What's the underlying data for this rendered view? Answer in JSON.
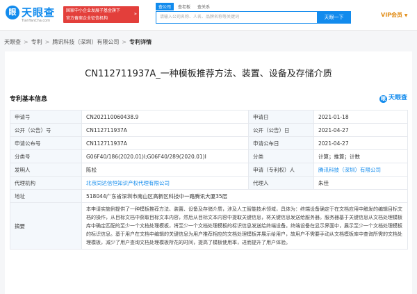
{
  "header": {
    "logo_mark": "眼",
    "logo_text": "天眼查",
    "logo_domain": "TianYanCha.com",
    "promo_line1": "国家中小企业发展子基金旗下",
    "promo_line2": "官方备案企业征信机构",
    "promo_arrow": "»",
    "search_tabs": [
      "查公司",
      "查老板",
      "查关系"
    ],
    "search_placeholder": "请输入公司名称、人名、品牌名称等关键词",
    "search_button": "天眼一下",
    "vip_label": "VIP会员",
    "vip_caret": "▼"
  },
  "breadcrumb": {
    "items": [
      "天眼查",
      "专利",
      "腾讯科技（深圳）有限公司",
      "专利详情"
    ],
    "separator": ">"
  },
  "page": {
    "title": "CN112711937A_一种模板推荐方法、装置、设备及存储介质",
    "section_title": "专利基本信息",
    "brand_mark_dot": "眼",
    "brand_mark_text": "天眼查"
  },
  "info": {
    "apply_no_label": "申请号",
    "apply_no": "CN202110060438.9",
    "apply_date_label": "申请日",
    "apply_date": "2021-01-18",
    "pub_no_label": "公开（公告）号",
    "pub_no": "CN112711937A",
    "pub_date_label": "公开（公告）日",
    "pub_date": "2021-04-27",
    "apply_pub_no_label": "申请公布号",
    "apply_pub_no": "CN112711937A",
    "apply_pub_date_label": "申请公布日",
    "apply_pub_date": "2021-04-27",
    "class_no_label": "分类号",
    "class_no": "G06F40/186(2020.01)I;G06F40/289(2020.01)I",
    "category_label": "分类",
    "category": "计算；推算；计数",
    "inventor_label": "发明人",
    "inventor": "陈松",
    "applicant_label": "申请（专利权）人",
    "applicant": "腾讯科技（深圳）有限公司",
    "agency_label": "代理机构",
    "agency": "北京同达信恒知识产权代理有限公司",
    "agent_label": "代理人",
    "agent": "朱佳",
    "address_label": "地址",
    "address": "518044广东省深圳市南山区高新区科技中一路腾讯大厦35层",
    "abstract_label": "摘要",
    "abstract": "本申请实施例提供了一种模板推荐方法、装置、设备及存储介质，涉及人工智能技术领域，具体为：终端设备确定于在文档应用中触发的编辑目标文档的操作，从目标文档中获取目标文本内容，然后从目标文本内容中提取关键信息，将关键信息发送给服务器。服务器基于关键信息从文档处理模板库中确定匹配的至少一个文档处理模板，将至少一个文档处理模板的标识信息发送给终端设备。终端设备在显示界面中，展示至少一个文档处理模板的标识信息。基于用户在文档中编辑的关键信息为用户推荐相应的文档处理模板并展示给用户，故用户不需要手动从文档模板库中查询所需的文档处理模板，减少了用户查询文档处理模板所花的时间，提高了模板使用率，进而提升了用户体验。"
  }
}
